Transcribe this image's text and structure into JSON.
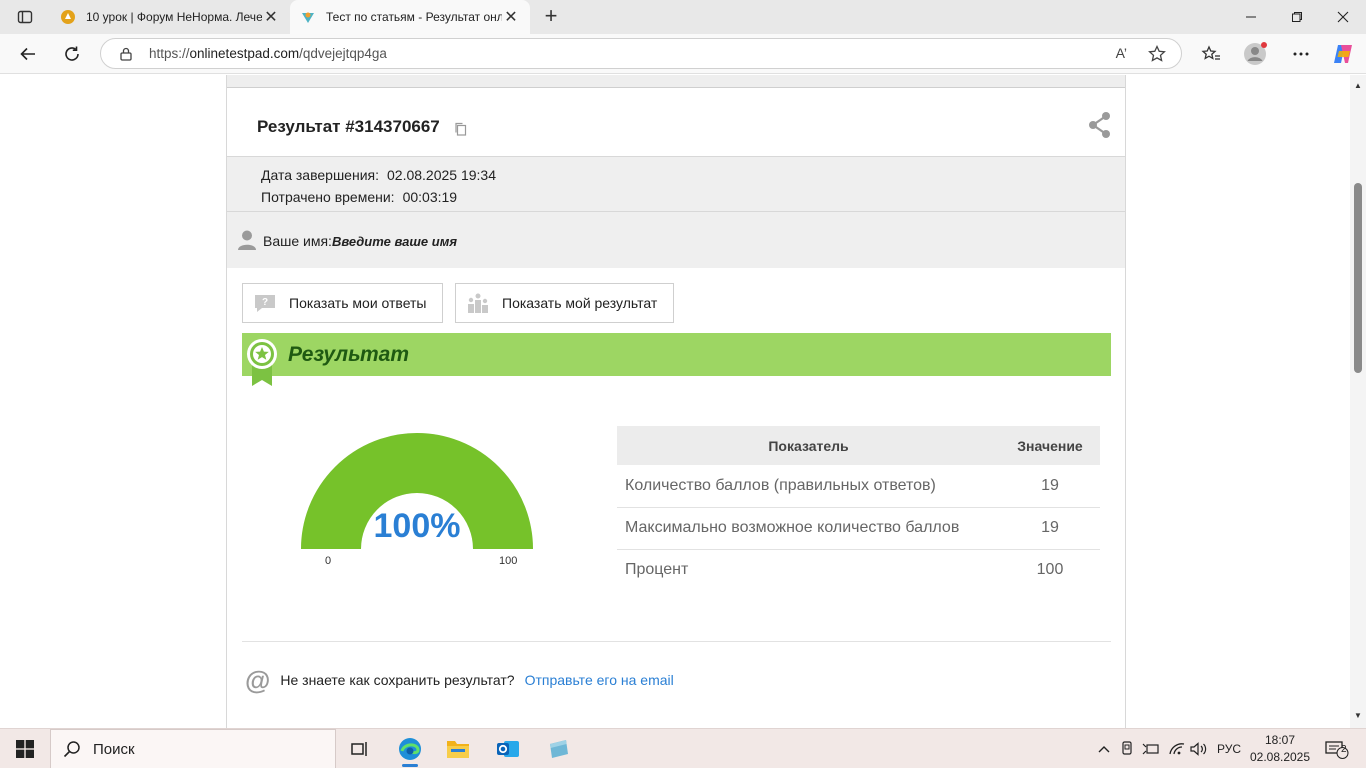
{
  "browser": {
    "tabs": [
      {
        "title": "10 урок | Форум НеНорма. Лече"
      },
      {
        "title": "Тест по статьям - Результат онла"
      }
    ],
    "url_prefix": "https://",
    "url_host": "onlinetestpad.com",
    "url_path": "/qdvejejtqp4ga",
    "read_aloud": "A’"
  },
  "result": {
    "heading": "Результат #314370667",
    "date_label": "Дата завершения:",
    "date_value": "02.08.2025 19:34",
    "time_label": "Потрачено времени:",
    "time_value": "00:03:19",
    "name_label": "Ваше имя:",
    "name_value": "Введите ваше имя",
    "btn_answers": "Показать мои ответы",
    "btn_result": "Показать мой результат",
    "banner_title": "Результат"
  },
  "gauge": {
    "percent_label": "100%",
    "value": 100,
    "min": "0",
    "max": "100",
    "color": "#76c22a",
    "track_color": "#e6e6e6"
  },
  "table": {
    "col_metric": "Показатель",
    "col_value": "Значение",
    "rows": [
      {
        "k": "Количество баллов (правильных ответов)",
        "v": "19"
      },
      {
        "k": "Максимально возможное количество баллов",
        "v": "19"
      },
      {
        "k": "Процент",
        "v": "100"
      }
    ]
  },
  "email": {
    "question": "Не знаете как сохранить результат?",
    "link": "Отправьте его на email"
  },
  "taskbar": {
    "search": "Поиск",
    "lang": "РУС",
    "time": "18:07",
    "date": "02.08.2025",
    "notifications": "2"
  },
  "colors": {
    "accent_green": "#9dd663",
    "link_blue": "#2a7fd4"
  }
}
